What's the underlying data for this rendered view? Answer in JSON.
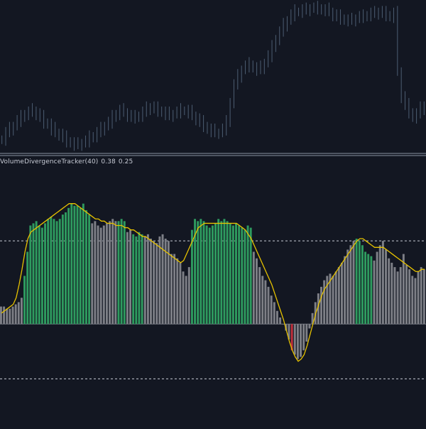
{
  "indicator": {
    "name": "VolumeDivergenceTracker(40)",
    "value1": "0.38",
    "value2": "0.25"
  },
  "colors": {
    "background": "#131722",
    "candle": "#4c5d72",
    "separator": "#8a93a3",
    "bar_positive": "#2e9b5f",
    "bar_neutral": "#7d7f86",
    "bar_negative": "#c2303c",
    "signal_line": "#e6c200",
    "dashed_level": "#c8ccd6"
  },
  "price_panel": {
    "price_series": [
      108,
      112,
      114,
      116,
      119,
      121,
      123,
      124,
      125,
      123,
      121,
      118,
      117,
      114,
      112,
      111,
      109,
      107,
      106,
      105,
      105,
      106,
      107,
      109,
      110,
      112,
      114,
      116,
      118,
      121,
      123,
      125,
      124,
      122,
      121,
      121,
      122,
      124,
      126,
      127,
      126,
      125,
      124,
      123,
      122,
      123,
      124,
      125,
      125,
      124,
      122,
      120,
      118,
      116,
      114,
      113,
      112,
      112,
      114,
      118,
      130,
      140,
      145,
      149,
      151,
      152,
      150,
      149,
      150,
      153,
      157,
      162,
      167,
      171,
      175,
      178,
      181,
      183,
      183,
      184,
      184,
      185,
      185,
      185,
      184,
      184,
      183,
      181,
      180,
      179,
      178,
      178,
      178,
      179,
      180,
      180,
      181,
      182,
      182,
      183,
      182,
      181,
      180,
      182,
      148,
      133,
      128,
      124,
      121,
      123,
      126,
      128
    ]
  },
  "indicator_panel": {
    "levels": {
      "upper": 0.38,
      "zero": 0.0,
      "lower": -0.25
    },
    "value_range": [
      -0.45,
      0.75
    ],
    "bars": [
      0.08,
      0.08,
      0.07,
      0.07,
      0.08,
      0.09,
      0.1,
      0.12,
      0.22,
      0.33,
      0.45,
      0.46,
      0.47,
      0.45,
      0.44,
      0.46,
      0.48,
      0.49,
      0.48,
      0.47,
      0.48,
      0.5,
      0.51,
      0.53,
      0.55,
      0.54,
      0.54,
      0.53,
      0.55,
      0.52,
      0.5,
      0.46,
      0.47,
      0.45,
      0.44,
      0.45,
      0.46,
      0.47,
      0.48,
      0.47,
      0.47,
      0.48,
      0.47,
      0.42,
      0.43,
      0.41,
      0.4,
      0.42,
      0.41,
      0.4,
      0.41,
      0.39,
      0.38,
      0.37,
      0.4,
      0.41,
      0.39,
      0.38,
      0.32,
      0.32,
      0.3,
      0.28,
      0.24,
      0.22,
      0.26,
      0.43,
      0.48,
      0.47,
      0.48,
      0.47,
      0.45,
      0.44,
      0.45,
      0.46,
      0.48,
      0.47,
      0.48,
      0.47,
      0.46,
      0.45,
      0.46,
      0.45,
      0.44,
      0.43,
      0.45,
      0.44,
      0.33,
      0.3,
      0.26,
      0.22,
      0.2,
      0.17,
      0.13,
      0.1,
      0.06,
      0.03,
      0.0,
      -0.03,
      -0.07,
      -0.12,
      -0.14,
      -0.16,
      -0.15,
      -0.12,
      -0.08,
      -0.02,
      0.05,
      0.1,
      0.14,
      0.17,
      0.2,
      0.22,
      0.23,
      0.22,
      0.24,
      0.26,
      0.28,
      0.31,
      0.34,
      0.36,
      0.38,
      0.39,
      0.38,
      0.36,
      0.33,
      0.32,
      0.31,
      0.29,
      0.33,
      0.36,
      0.38,
      0.34,
      0.3,
      0.28,
      0.26,
      0.24,
      0.26,
      0.32,
      0.27,
      0.25,
      0.22,
      0.21,
      0.24,
      0.26,
      0.25
    ],
    "bar_states": [
      "n",
      "n",
      "n",
      "n",
      "n",
      "n",
      "n",
      "n",
      "p",
      "p",
      "p",
      "p",
      "p",
      "p",
      "p",
      "p",
      "p",
      "p",
      "p",
      "p",
      "p",
      "p",
      "p",
      "p",
      "p",
      "p",
      "p",
      "p",
      "p",
      "p",
      "p",
      "n",
      "n",
      "n",
      "n",
      "n",
      "n",
      "n",
      "n",
      "n",
      "p",
      "p",
      "p",
      "n",
      "n",
      "p",
      "p",
      "p",
      "p",
      "n",
      "n",
      "n",
      "n",
      "n",
      "n",
      "n",
      "n",
      "n",
      "n",
      "n",
      "n",
      "n",
      "n",
      "n",
      "n",
      "p",
      "p",
      "p",
      "p",
      "p",
      "p",
      "p",
      "p",
      "p",
      "p",
      "p",
      "p",
      "p",
      "p",
      "p",
      "p",
      "p",
      "p",
      "p",
      "p",
      "p",
      "n",
      "n",
      "n",
      "n",
      "n",
      "n",
      "n",
      "n",
      "n",
      "n",
      "n",
      "n",
      "n",
      "r",
      "n",
      "n",
      "n",
      "n",
      "n",
      "n",
      "n",
      "n",
      "n",
      "n",
      "n",
      "n",
      "n",
      "n",
      "n",
      "n",
      "n",
      "n",
      "n",
      "n",
      "n",
      "p",
      "p",
      "p",
      "p",
      "p",
      "p",
      "n",
      "n",
      "n",
      "n",
      "n",
      "n",
      "n",
      "n",
      "n",
      "n",
      "n",
      "n",
      "n",
      "n",
      "n",
      "n",
      "n",
      "n"
    ],
    "signal_line": [
      0.05,
      0.06,
      0.07,
      0.08,
      0.09,
      0.12,
      0.18,
      0.25,
      0.33,
      0.39,
      0.42,
      0.43,
      0.44,
      0.45,
      0.46,
      0.47,
      0.48,
      0.49,
      0.5,
      0.51,
      0.52,
      0.53,
      0.54,
      0.55,
      0.55,
      0.55,
      0.54,
      0.53,
      0.52,
      0.51,
      0.5,
      0.49,
      0.48,
      0.48,
      0.47,
      0.47,
      0.46,
      0.46,
      0.46,
      0.45,
      0.45,
      0.45,
      0.44,
      0.44,
      0.43,
      0.43,
      0.42,
      0.41,
      0.4,
      0.4,
      0.39,
      0.38,
      0.37,
      0.36,
      0.35,
      0.34,
      0.33,
      0.32,
      0.31,
      0.3,
      0.29,
      0.28,
      0.29,
      0.32,
      0.35,
      0.38,
      0.41,
      0.44,
      0.45,
      0.46,
      0.46,
      0.46,
      0.46,
      0.46,
      0.46,
      0.46,
      0.46,
      0.46,
      0.46,
      0.46,
      0.46,
      0.45,
      0.44,
      0.43,
      0.41,
      0.39,
      0.36,
      0.33,
      0.3,
      0.27,
      0.24,
      0.21,
      0.18,
      0.14,
      0.1,
      0.06,
      0.02,
      -0.03,
      -0.08,
      -0.12,
      -0.15,
      -0.17,
      -0.16,
      -0.14,
      -0.1,
      -0.05,
      0.0,
      0.05,
      0.09,
      0.13,
      0.16,
      0.18,
      0.2,
      0.22,
      0.24,
      0.26,
      0.28,
      0.3,
      0.32,
      0.34,
      0.36,
      0.38,
      0.39,
      0.39,
      0.38,
      0.37,
      0.36,
      0.35,
      0.35,
      0.35,
      0.35,
      0.34,
      0.33,
      0.32,
      0.31,
      0.3,
      0.29,
      0.28,
      0.27,
      0.26,
      0.25,
      0.24,
      0.24,
      0.25,
      0.25
    ]
  }
}
